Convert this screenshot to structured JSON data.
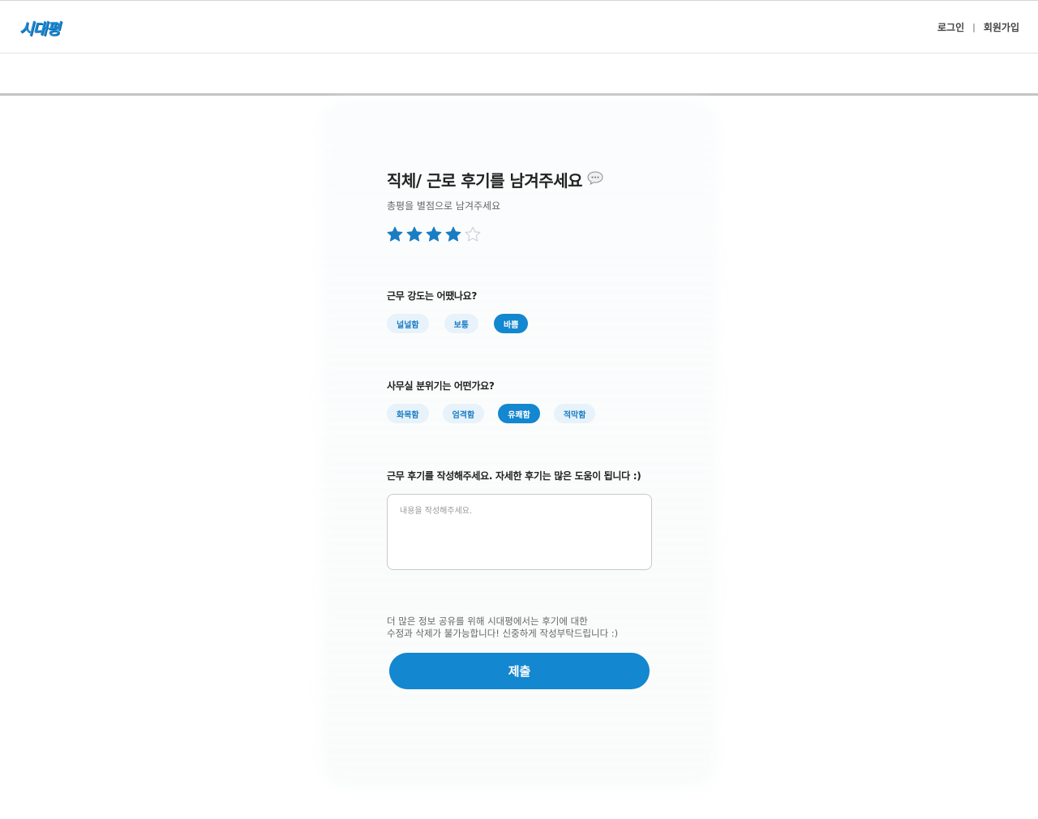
{
  "header": {
    "logo_text": "시대평",
    "login_label": "로그인",
    "separator": "|",
    "signup_label": "회원가입"
  },
  "review": {
    "title": "직체/ 근로 후기를 남겨주세요",
    "title_icon": "speech-bubble-icon",
    "subtitle": "총평을 별점으로 남겨주세요",
    "rating": {
      "value": 4,
      "max": 5
    },
    "intensity": {
      "question": "근무 강도는 어땠나요?",
      "options": [
        "널널함",
        "보통",
        "바쁨"
      ],
      "selected": "바쁨"
    },
    "atmosphere": {
      "question": "사무실 분위기는 어떤가요?",
      "options": [
        "화목함",
        "엄격함",
        "유쾌함",
        "적막함"
      ],
      "selected": "유쾌함"
    },
    "comment": {
      "question": "근무 후기를 작성해주세요. 자세한 후기는 많은 도움이 됩니다 :)",
      "placeholder": "내용을 작성해주세요.",
      "value": ""
    },
    "notice_line1": "더 많은 정보 공유를 위해 시대평에서는 후기에 대한",
    "notice_line2": "수정과 삭제가 불가능합니다! 신중하게 작성부탁드립니다 :)",
    "submit_label": "제출"
  },
  "colors": {
    "accent": "#1387cf",
    "chip_bg": "#e8f2fb",
    "star_filled": "#1a7dc4",
    "star_empty": "#c8d3dc"
  }
}
